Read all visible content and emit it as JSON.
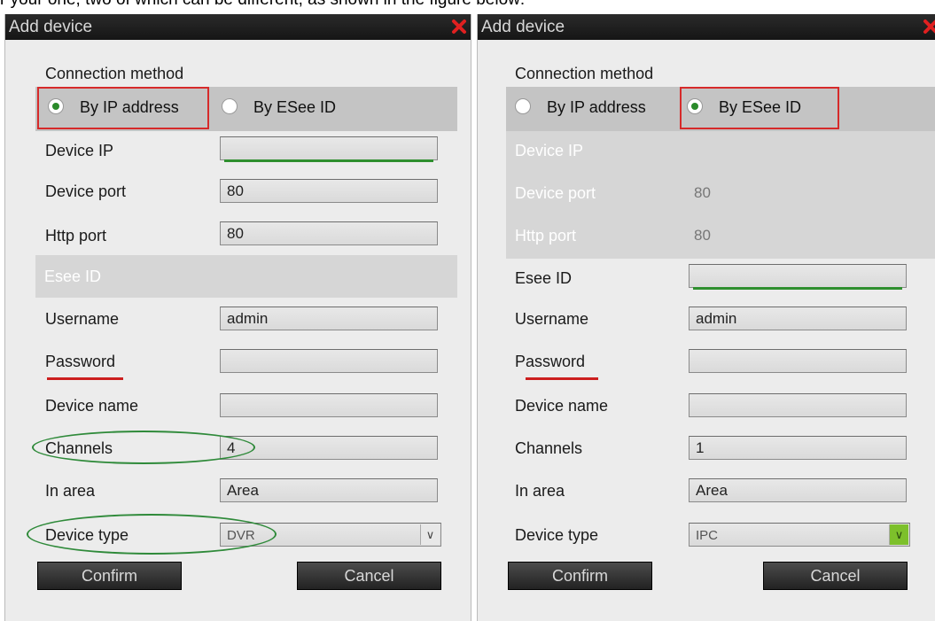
{
  "caption": "r your one, two of which can be different, as shown in the figure  below:",
  "dialogs": [
    {
      "title": "Add device",
      "connection_method_label": "Connection method",
      "radio_ip_label": "By IP address",
      "radio_esee_label": "By ESee ID",
      "selected": "ip",
      "fields": {
        "device_ip": {
          "label": "Device IP",
          "value": ""
        },
        "device_port": {
          "label": "Device port",
          "value": "80"
        },
        "http_port": {
          "label": "Http port",
          "value": "80"
        },
        "esee_id": {
          "label": "Esee ID",
          "value": ""
        },
        "username": {
          "label": "Username",
          "value": "admin"
        },
        "password": {
          "label": "Password",
          "value": ""
        },
        "device_name": {
          "label": "Device name",
          "value": ""
        },
        "channels": {
          "label": "Channels",
          "value": "4"
        },
        "in_area": {
          "label": "In area",
          "value": "Area"
        },
        "device_type": {
          "label": "Device type",
          "value": "DVR"
        }
      },
      "confirm_label": "Confirm",
      "cancel_label": "Cancel"
    },
    {
      "title": "Add device",
      "connection_method_label": "Connection method",
      "radio_ip_label": "By IP address",
      "radio_esee_label": "By ESee ID",
      "selected": "esee",
      "fields": {
        "device_ip": {
          "label": "Device IP",
          "value": ""
        },
        "device_port": {
          "label": "Device port",
          "value": "80"
        },
        "http_port": {
          "label": "Http port",
          "value": "80"
        },
        "esee_id": {
          "label": "Esee ID",
          "value": ""
        },
        "username": {
          "label": "Username",
          "value": "admin"
        },
        "password": {
          "label": "Password",
          "value": ""
        },
        "device_name": {
          "label": "Device name",
          "value": ""
        },
        "channels": {
          "label": "Channels",
          "value": "1"
        },
        "in_area": {
          "label": "In area",
          "value": "Area"
        },
        "device_type": {
          "label": "Device type",
          "value": "IPC"
        }
      },
      "confirm_label": "Confirm",
      "cancel_label": "Cancel"
    }
  ],
  "icons": {
    "close": "close-x-icon",
    "dropdown": "chevron-down-icon"
  },
  "colors": {
    "titlebar": "#1e1e1e",
    "panel": "#ececec",
    "radio_bar": "#c4c4c4",
    "annotation_red": "#d62a2a",
    "annotation_green": "#2f8a3a",
    "dropdown_green": "#7dc02b"
  }
}
